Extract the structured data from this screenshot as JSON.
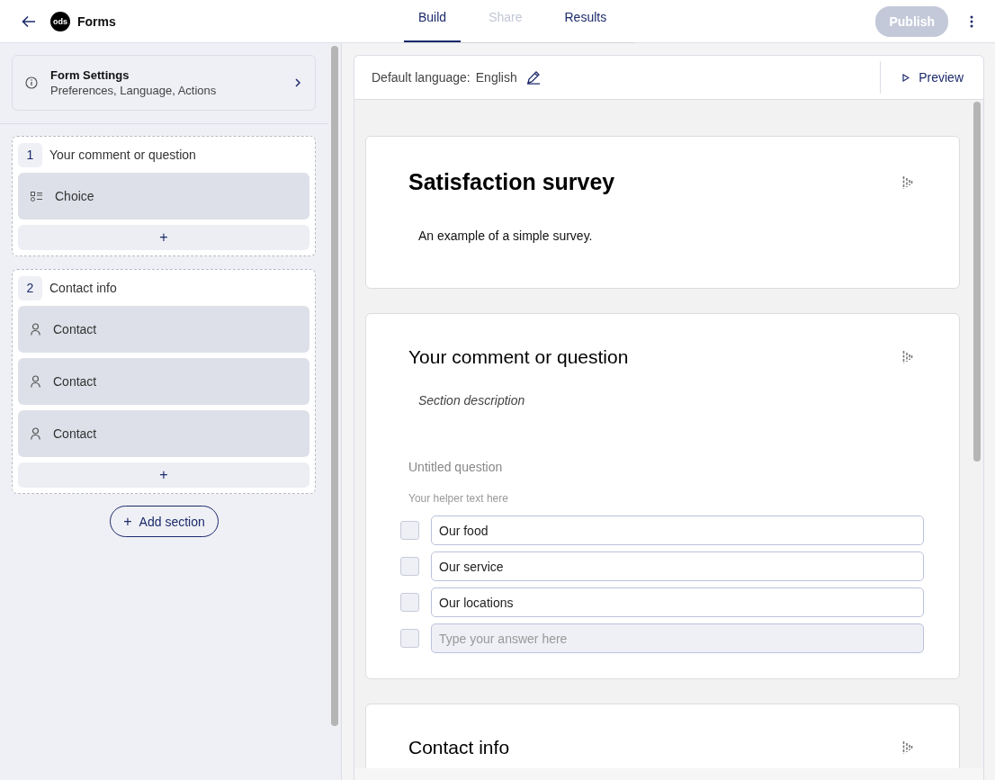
{
  "header": {
    "title": "Forms",
    "logo": "ods",
    "publish_label": "Publish",
    "publish_disabled": true
  },
  "tabs": [
    {
      "label": "Build",
      "selected": true,
      "disabled": false
    },
    {
      "label": "Share",
      "selected": false,
      "disabled": true
    },
    {
      "label": "Results",
      "selected": false,
      "disabled": false
    }
  ],
  "sidebar": {
    "settings": {
      "title": "Form Settings",
      "subtitle": "Preferences, Language, Actions"
    },
    "sections": [
      {
        "number": "1",
        "title": "Your comment or question",
        "items": [
          {
            "kind": "choice",
            "label": "Choice"
          }
        ],
        "add_label": "+"
      },
      {
        "number": "2",
        "title": "Contact info",
        "items": [
          {
            "kind": "contact",
            "label": "Contact"
          },
          {
            "kind": "contact",
            "label": "Contact"
          },
          {
            "kind": "contact",
            "label": "Contact"
          }
        ],
        "add_label": "+"
      }
    ],
    "add_section": {
      "icon": "+",
      "label": "Add section"
    }
  },
  "editor": {
    "language_label": "Default language:",
    "language": "English",
    "preview_label": "Preview",
    "form": {
      "title": "Satisfaction survey",
      "description": "An example of a simple survey."
    },
    "sections": [
      {
        "title": "Your comment or question",
        "description": "Section description",
        "question": {
          "title": "Untitled question",
          "helper": "Your helper text here",
          "options": [
            {
              "value": "Our food",
              "checked": false
            },
            {
              "value": "Our service",
              "checked": false
            },
            {
              "value": "Our locations",
              "checked": false
            },
            {
              "placeholder": "Type your answer here",
              "checked": false
            }
          ]
        }
      },
      {
        "title": "Contact info"
      }
    ]
  }
}
